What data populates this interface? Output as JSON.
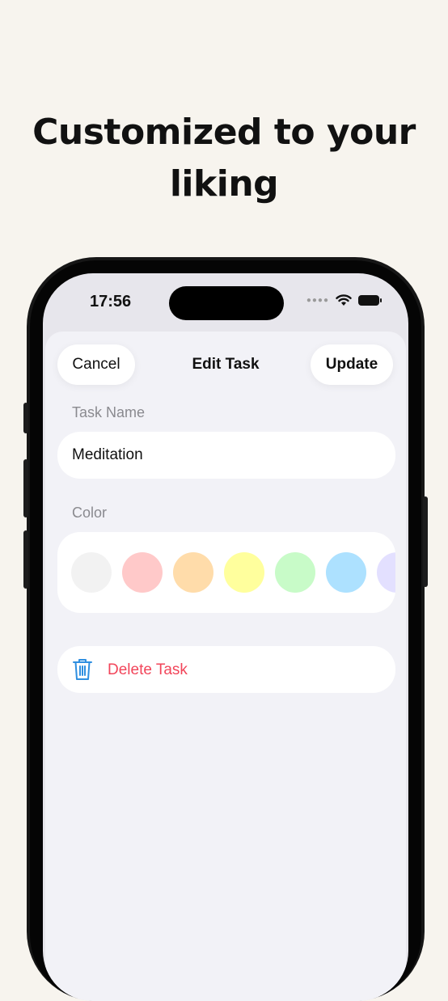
{
  "headline": {
    "line1": "Customized to your",
    "line2": "liking"
  },
  "status_bar": {
    "time": "17:56"
  },
  "nav": {
    "cancel_label": "Cancel",
    "title": "Edit Task",
    "update_label": "Update"
  },
  "form": {
    "task_name_label": "Task Name",
    "task_name_value": "Meditation",
    "color_label": "Color",
    "colors": [
      "#f2f2f2",
      "#ffc9c9",
      "#ffdcaa",
      "#ffff9d",
      "#c8fbc8",
      "#ade1ff",
      "#e3e0ff"
    ],
    "delete_label": "Delete Task",
    "delete_color": "#f2455a",
    "trash_icon_color": "#2f8fe0"
  }
}
